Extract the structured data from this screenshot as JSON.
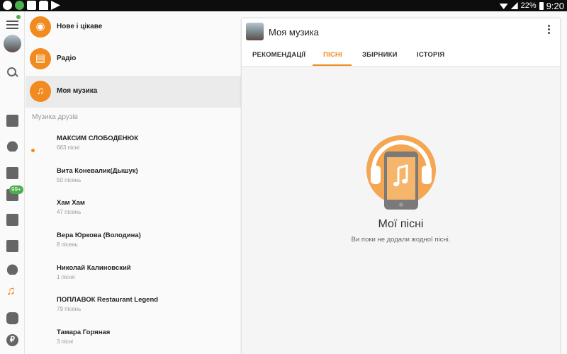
{
  "status_bar": {
    "battery": "22%",
    "time": "9:20",
    "icons": [
      "ok-icon",
      "check-icon",
      "image-icon",
      "store-icon",
      "play-icon"
    ]
  },
  "rail": {
    "badge": "99+",
    "icons": [
      "menu-icon",
      "avatar",
      "search-icon",
      "news-icon",
      "friends-icon",
      "mail-icon",
      "chat-icon",
      "photo-icon",
      "video-icon",
      "groups-icon",
      "music-icon",
      "games-icon",
      "ruble-icon"
    ]
  },
  "sidebar": {
    "items": [
      {
        "label": "Нове і цікаве",
        "icon": "ok-podcast-icon"
      },
      {
        "label": "Радіо",
        "icon": "radio-icon"
      },
      {
        "label": "Моя музика",
        "icon": "music-note-icon"
      }
    ],
    "section_title": "Музика друзів",
    "friends": [
      {
        "name": "МАКСИМ СЛОБОДЕНЮК",
        "count": "663 пісні"
      },
      {
        "name": "Вита Коневалик(Дышук)",
        "count": "50 пісень"
      },
      {
        "name": "Хам Хам",
        "count": "47 пісень"
      },
      {
        "name": "Вера Юркова (Володина)",
        "count": "8 пісень"
      },
      {
        "name": "Николай Калиновский",
        "count": "1 пісня"
      },
      {
        "name": "ПОПЛАВОК Restaurant Legend",
        "count": "79 пісень"
      },
      {
        "name": "Тамара Горяная",
        "count": "3 пісні"
      }
    ]
  },
  "panel": {
    "title": "Моя музика",
    "tabs": [
      "РЕКОМЕНДАЦІЇ",
      "ПІСНІ",
      "ЗБІРНИКИ",
      "ІСТОРІЯ"
    ],
    "active_tab": "ПІСНІ",
    "empty_title": "Мої пісні",
    "empty_subtitle": "Ви поки не додали жодної пісні."
  },
  "colors": {
    "accent": "#f18a1f",
    "online": "#4caf50"
  }
}
